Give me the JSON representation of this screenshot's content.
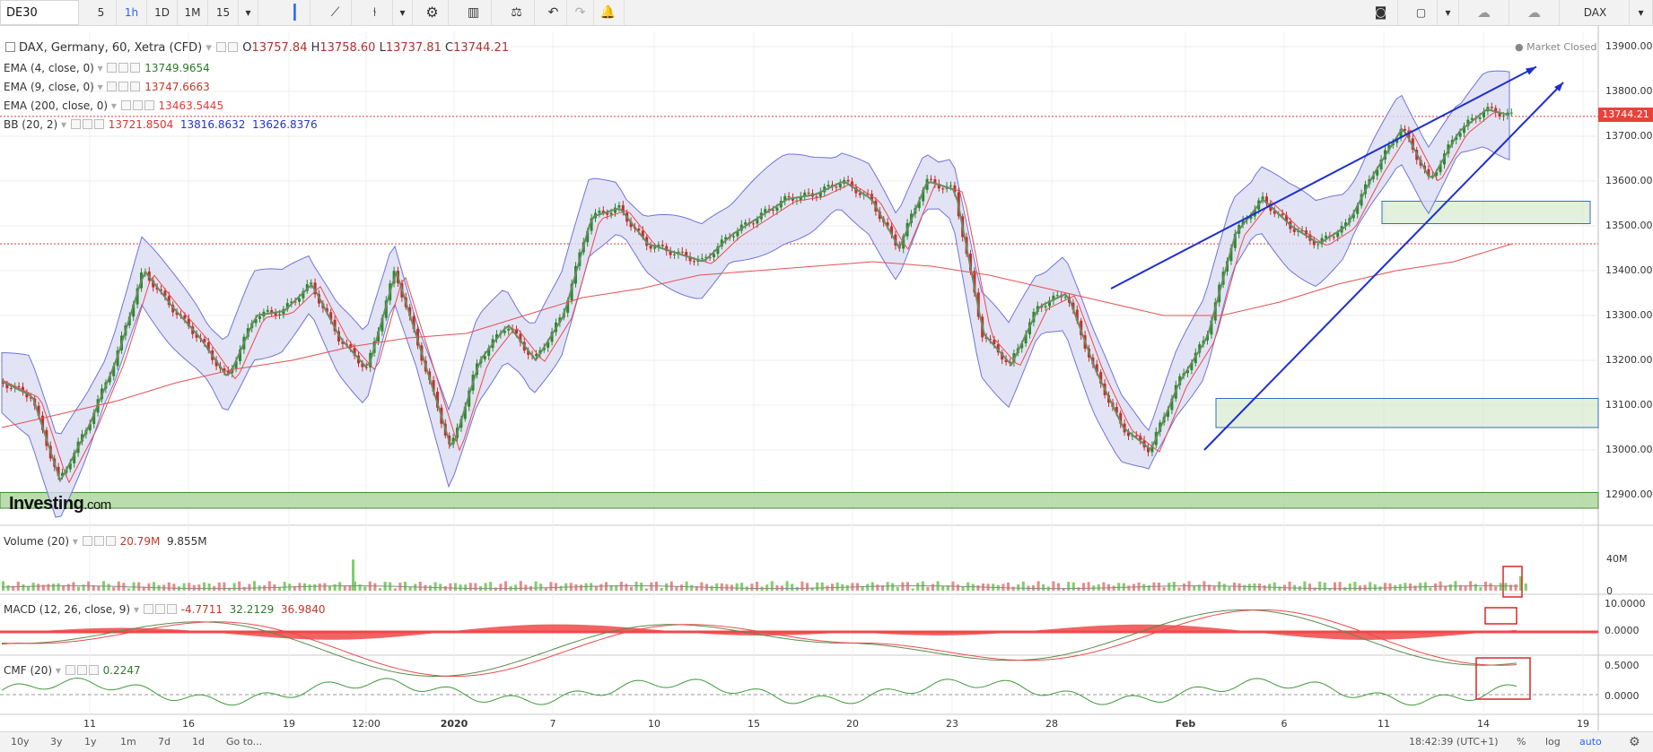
{
  "toolbar": {
    "symbol": "DE30",
    "intervals": [
      "5",
      "1h",
      "1D",
      "1M",
      "15"
    ],
    "active_interval": "1h",
    "symbol_right": "DAX"
  },
  "legend": {
    "title": "DAX, Germany, 60, Xetra (CFD)",
    "ohlc": {
      "o": "13757.84",
      "h": "13758.60",
      "l": "13737.81",
      "c": "13744.21"
    },
    "o_label": "O",
    "h_label": "H",
    "l_label": "L",
    "c_label": "C",
    "ema4": {
      "name": "EMA (4, close, 0)",
      "value": "13749.9654"
    },
    "ema9": {
      "name": "EMA (9, close, 0)",
      "value": "13747.6663"
    },
    "ema200": {
      "name": "EMA (200, close, 0)",
      "value": "13463.5445"
    },
    "bb": {
      "name": "BB (20, 2)",
      "mid": "13721.8504",
      "upper": "13816.8632",
      "lower": "13626.8376"
    },
    "volume": {
      "name": "Volume (20)",
      "v1": "20.79M",
      "v2": "9.855M"
    },
    "macd": {
      "name": "MACD (12, 26, close, 9)",
      "v1": "-4.7711",
      "v2": "32.2129",
      "v3": "36.9840"
    },
    "cmf": {
      "name": "CMF (20)",
      "value": "0.2247"
    }
  },
  "market_status": "Market Closed",
  "watermark": {
    "brand": "Investing",
    "suffix": ".com"
  },
  "price_axis": [
    "13900.00",
    "13800.00",
    "13700.00",
    "13600.00",
    "13500.00",
    "13400.00",
    "13300.00",
    "13200.00",
    "13100.00",
    "13000.00",
    "12900.00"
  ],
  "last_price": "13744.21",
  "volume_axis": [
    "40M",
    "0"
  ],
  "macd_axis": [
    "10.0000",
    "0.0000"
  ],
  "cmf_axis": [
    "0.5000",
    "0.0000"
  ],
  "time_axis": [
    "11",
    "16",
    "19",
    "12:00",
    "2020",
    "7",
    "10",
    "15",
    "20",
    "23",
    "28",
    "Feb",
    "6",
    "11",
    "14",
    "19"
  ],
  "bottom": {
    "ranges": [
      "10y",
      "3y",
      "1y",
      "1m",
      "7d",
      "1d",
      "Go to..."
    ],
    "clock": "18:42:39 (UTC+1)",
    "opts": [
      "%",
      "log",
      "auto"
    ]
  },
  "colors": {
    "up": "#2a8a2a",
    "down": "#c2302b",
    "bb": "#6f74d8",
    "ema_slow": "#e84c4c",
    "ema_fast": "#3a7b3a",
    "trend": "#1b2fcf",
    "zone": "#cfe6c4"
  },
  "chart_data": [
    {
      "type": "candlestick",
      "title": "DAX, Germany, 60, Xetra (CFD)",
      "ylim": [
        12870,
        13920
      ],
      "x": [
        "11",
        "16",
        "19",
        "12:00",
        "2020",
        "7",
        "10",
        "15",
        "20",
        "23",
        "28",
        "Feb",
        "6",
        "11",
        "14",
        "19"
      ],
      "close_path": [
        13150,
        13120,
        12930,
        13050,
        13200,
        13400,
        13320,
        13250,
        13160,
        13300,
        13310,
        13370,
        13250,
        13180,
        13400,
        13200,
        13000,
        13200,
        13280,
        13200,
        13300,
        13520,
        13540,
        13460,
        13440,
        13420,
        13480,
        13520,
        13560,
        13570,
        13600,
        13560,
        13450,
        13600,
        13580,
        13260,
        13190,
        13320,
        13350,
        13180,
        13050,
        13000,
        13150,
        13250,
        13480,
        13560,
        13500,
        13460,
        13500,
        13620,
        13720,
        13600,
        13710,
        13760,
        13744
      ],
      "ema200_path": [
        13050,
        13080,
        13110,
        13150,
        13180,
        13200,
        13230,
        13250,
        13260,
        13300,
        13340,
        13360,
        13390,
        13400,
        13410,
        13420,
        13410,
        13390,
        13360,
        13330,
        13300,
        13300,
        13330,
        13370,
        13400,
        13420,
        13460
      ],
      "bollinger": {
        "mid": "13721.8504",
        "upper": "13816.8632",
        "lower": "13626.8376"
      },
      "last_price": 13744.21,
      "trendlines": [
        [
          13360,
          13855
        ],
        [
          13000,
          13820
        ]
      ],
      "support_zones": [
        [
          13505,
          13555
        ],
        [
          13050,
          13115
        ],
        [
          12880,
          12905
        ]
      ]
    },
    {
      "type": "bar",
      "title": "Volume (20)",
      "ylim": [
        0,
        48
      ],
      "unit": "M",
      "values": [
        20.79,
        9.855
      ]
    },
    {
      "type": "line",
      "title": "MACD (12, 26, close, 9)",
      "ylim": [
        -8,
        12
      ],
      "values": [
        -4.7711,
        32.2129,
        36.984
      ]
    },
    {
      "type": "line",
      "title": "CMF (20)",
      "ylim": [
        -0.2,
        0.6
      ],
      "last_value": 0.2247
    }
  ]
}
